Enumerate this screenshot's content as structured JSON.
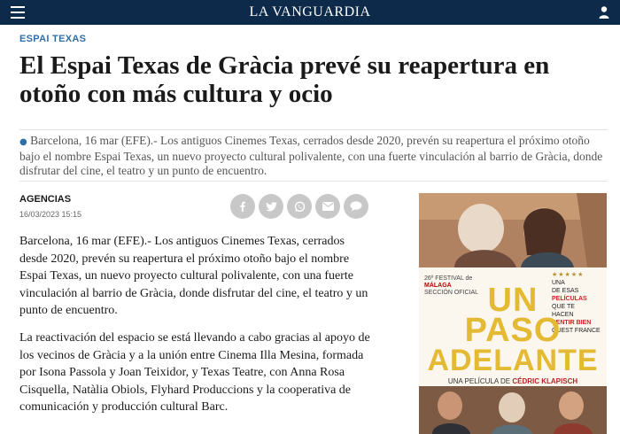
{
  "header": {
    "logo": "LA VANGUARDIA",
    "menu_icon": "hamburger-icon",
    "user_icon": "user-icon",
    "bg_color": "#0d2a4a"
  },
  "article": {
    "section": "ESPAI TEXAS",
    "headline": "El Espai Texas de Gràcia prevé su reapertura en otoño con más cultura y ocio",
    "summary": "Barcelona, 16 mar (EFE).- Los antiguos Cinemes Texas, cerrados desde 2020, prevén su reapertura el próximo otoño bajo el nombre Espai Texas, un nuevo proyecto cultural polivalente, con una fuerte vinculación al barrio de Gràcia, donde disfrutar del cine, el teatro y un punto de encuentro.",
    "author": "AGENCIAS",
    "date": "16/03/2023 15:15",
    "paragraphs": [
      "Barcelona, 16 mar (EFE).- Los antiguos Cinemes Texas, cerrados desde 2020, prevén su reapertura el próximo otoño bajo el nombre Espai Texas, un nuevo proyecto cultural polivalente, con una fuerte vinculación al barrio de Gràcia, donde disfrutar del cine, el teatro y un punto de encuentro.",
      "La reactivación del espacio se está llevando a cabo gracias al apoyo de los vecinos de Gràcia y a la unión entre Cinema Illa Mesina, formada por Isona Passola y Joan Teixidor, y Texas Teatre, con Anna Rosa Cisquella, Natàlia Obiols, Flyhard Produccions y la cooperativa de comunicación y producción cultural Barc."
    ],
    "accent_color": "#2f6fa8"
  },
  "share_buttons": [
    {
      "icon": "facebook-icon"
    },
    {
      "icon": "twitter-icon"
    },
    {
      "icon": "whatsapp-icon"
    },
    {
      "icon": "email-icon"
    },
    {
      "icon": "comment-icon"
    }
  ],
  "ad": {
    "festival_line1": "26º FESTIVAL de",
    "festival_line2": "MÁLAGA",
    "festival_line3": "SECCIÓN OFICIAL",
    "quote_stars": "★★★★★",
    "quote_lines": [
      "UNA",
      "DE ESAS",
      "PELÍCULAS",
      "QUE TE",
      "HACEN",
      "SENTIR BIEN"
    ],
    "quote_source": "GUEST FRANCE",
    "title_line1": "UN",
    "title_line2": "PASO",
    "title_line3": "ADELANTE",
    "film_by_prefix": "UNA PELÍCULA DE",
    "director": "CÉDRIC KLAPISCH"
  }
}
